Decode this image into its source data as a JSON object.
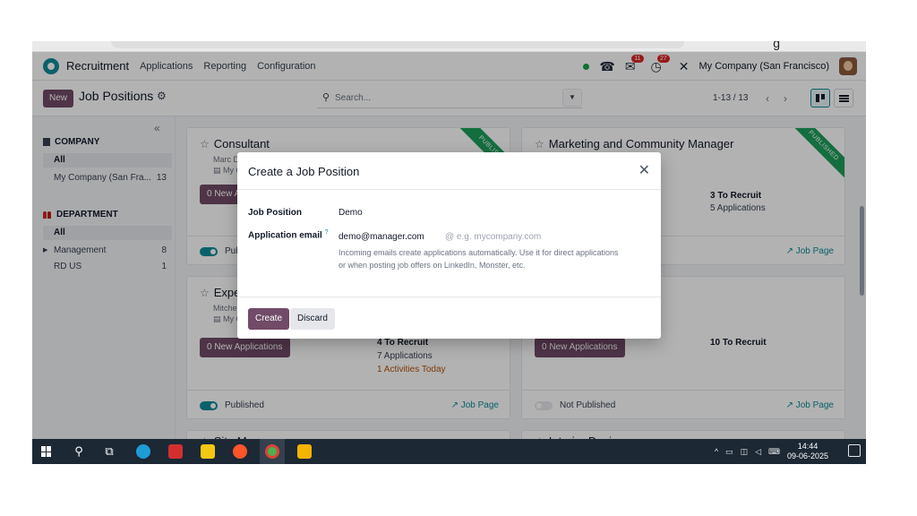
{
  "browser": {
    "glyph": "g"
  },
  "navbar": {
    "app_name": "Recruitment",
    "menu": [
      "Applications",
      "Reporting",
      "Configuration"
    ],
    "chat_badge": "11",
    "activity_badge": "27",
    "company": "My Company (San Francisco)"
  },
  "control_panel": {
    "new_label": "New",
    "title": "Job Positions",
    "search_placeholder": "Search...",
    "pager": "1-13 / 13"
  },
  "sidebar": {
    "company_header": "COMPANY",
    "company_items": [
      {
        "label": "All",
        "count": ""
      },
      {
        "label": "My Company (San Fra...",
        "count": "13"
      }
    ],
    "department_header": "DEPARTMENT",
    "department_items": [
      {
        "label": "All",
        "count": ""
      },
      {
        "label": "Management",
        "count": "8"
      },
      {
        "label": "RD US",
        "count": "1"
      }
    ]
  },
  "cards": [
    {
      "title": "Consultant",
      "sub1": "Marc D",
      "sub2": "My C",
      "apps_btn": "0 New A",
      "status": "Pub",
      "ribbon": "PUBLIS",
      "published": true
    },
    {
      "title": "Marketing and Community Manager",
      "to_recruit": "3 To Recruit",
      "applications": "5 Applications",
      "job_page": "Job Page",
      "ribbon": "PUBLISHED",
      "published": true
    },
    {
      "title": "Exper",
      "sub1": "Mitche",
      "sub2": "My C",
      "apps_btn": "0 New Applications",
      "to_recruit": "4 To Recruit",
      "applications": "7 Applications",
      "activities": "1 Activities Today",
      "status": "Published",
      "job_page": "Job Page",
      "published": true
    },
    {
      "title": "",
      "apps_btn": "0 New Applications",
      "to_recruit": "10 To Recruit",
      "status": "Not Published",
      "job_page": "Job Page",
      "published": false
    },
    {
      "title": "Site Manager"
    },
    {
      "title": "Interior Designer"
    }
  ],
  "dialog": {
    "title": "Create a Job Position",
    "job_position_label": "Job Position",
    "job_position_value": "Demo",
    "email_label": "Application email",
    "email_help_marker": "?",
    "email_value": "demo@manager.com",
    "email_placeholder": "@ e.g. mycompany.com",
    "email_help": "Incoming emails create applications automatically. Use it for direct applications or when posting job offers on LinkedIn, Monster, etc.",
    "create_label": "Create",
    "discard_label": "Discard"
  },
  "taskbar": {
    "time": "14:44",
    "date": "09-06-2025"
  },
  "colors": {
    "brand": "#714b67",
    "accent": "#0f8b9a",
    "ribbon": "#1e9e5b"
  }
}
